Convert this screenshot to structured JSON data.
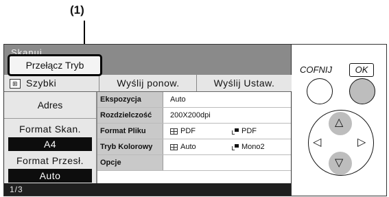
{
  "callout": "(1)",
  "screen": {
    "title": "Skanuj",
    "mode_button": "Przełącz Tryb",
    "tabs": [
      "Szybki",
      "Wyślij ponow.",
      "Wyślij Ustaw."
    ],
    "left": {
      "address": "Adres",
      "scan_format_label": "Format Skan.",
      "scan_format_value": "A4",
      "send_format_label": "Format Przesł.",
      "send_format_value": "Auto"
    },
    "settings": [
      {
        "key": "Ekspozycja",
        "value": "Auto"
      },
      {
        "key": "Rozdzielczość",
        "value": "200X200dpi"
      },
      {
        "key": "Format Pliku",
        "color_value": "PDF",
        "mono_value": "PDF"
      },
      {
        "key": "Tryb Kolorowy",
        "color_value": "Auto",
        "mono_value": "Mono2"
      },
      {
        "key": "Opcje",
        "value": ""
      }
    ],
    "page": "1/3"
  },
  "panel": {
    "back_label": "COFNIJ",
    "ok_label": "OK",
    "icons": {
      "up": "triangle-up",
      "down": "triangle-down",
      "left": "triangle-left",
      "right": "triangle-right"
    }
  },
  "colors": {
    "lcd_bg": "#8a8a8a",
    "footer": "#1f1f1f",
    "value_bg": "#0d0d0d",
    "highlight": "#bdbdbd"
  }
}
